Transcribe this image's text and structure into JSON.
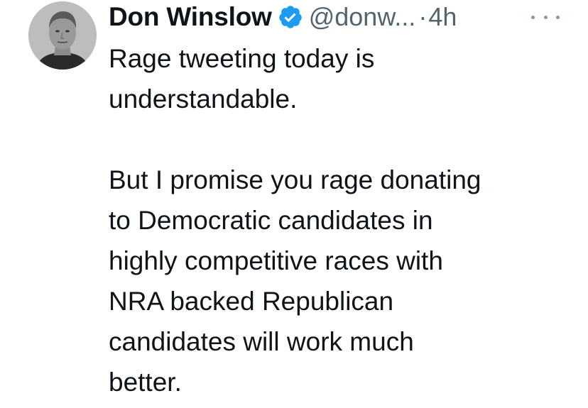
{
  "author": {
    "name": "Don Winslow",
    "handle": "@donw...",
    "separator": "·",
    "time": "4h",
    "verified": true,
    "avatar_icon": "profile-photo"
  },
  "tweet": {
    "paragraph1_line1": "Rage tweeting today is",
    "paragraph1_line2": "understandable.",
    "paragraph2_line1": "But I promise you rage donating",
    "paragraph2_line2": "to Democratic candidates in",
    "paragraph2_line3": "highly competitive races with",
    "paragraph2_line4": "NRA backed Republican",
    "paragraph2_line5": "candidates will work much",
    "paragraph2_line6": "better."
  },
  "colors": {
    "text": "#0f1419",
    "muted": "#536471",
    "verified": "#1d9bf0"
  },
  "icons": {
    "more": "more-horizontal-icon",
    "verified": "verified-badge-icon"
  }
}
